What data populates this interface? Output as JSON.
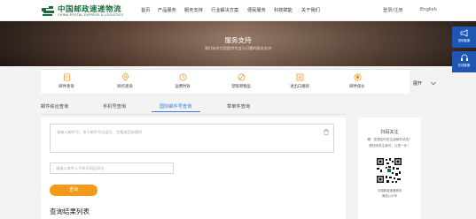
{
  "header": {
    "logo_cn": "中国邮政速递物流",
    "logo_en": "CHINA POSTAL EXPRESS & LOGISTICS",
    "nav": [
      "首页",
      "产品服务",
      "服务支持",
      "行业解决方案",
      "便民服务",
      "科技赋能",
      "关于我们"
    ],
    "login": "登录/注册",
    "lang": "English"
  },
  "hero": {
    "title": "服务支持",
    "subtitle": "我们始终为您提供专业与可靠的服务支持"
  },
  "side": {
    "service_label": "官网客服",
    "line_label": "在线客服"
  },
  "services": [
    {
      "label": "邮件查询",
      "icon": "document-icon"
    },
    {
      "label": "网点查询",
      "icon": "location-icon"
    },
    {
      "label": "运费时效",
      "icon": "clock-icon"
    },
    {
      "label": "禁限寄物品",
      "icon": "prohibited-icon"
    },
    {
      "label": "进出口规则",
      "icon": "rules-icon"
    },
    {
      "label": "邮件保价",
      "icon": "shield-icon"
    }
  ],
  "services_more": "展开",
  "tabs": [
    "邮件综合查询",
    "手机号查询",
    "国际邮件号查询",
    "草单件查询"
  ],
  "active_tab": 2,
  "form": {
    "textarea_placeholder": "请输入邮件号，多个邮件号以逗号、空格或回车隔开",
    "phone_placeholder": "请输入收件人手机号码后四位",
    "query_button": "查询",
    "result_title": "查询结果列表"
  },
  "right_card": {
    "title": "扫码关注",
    "line1": "哪！您想实时关注此邮件状态？",
    "line2": "请扫码关注我们，让您一步！",
    "caption1": "中国邮政速递物流",
    "caption2": "微信公众号"
  },
  "colors": {
    "accent": "#3a7bd5",
    "brand_green": "#1a6e3a",
    "orange": "#f39a1c",
    "side_blue": "#1f56b3"
  }
}
